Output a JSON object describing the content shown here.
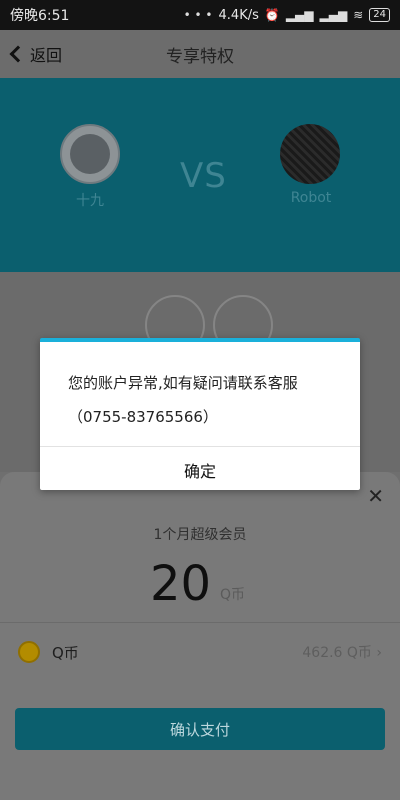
{
  "status_bar": {
    "time": "傍晚6:51",
    "net_speed": "4.4K/s",
    "battery": "24"
  },
  "header": {
    "back_label": "返回",
    "title": "专享特权"
  },
  "versus": {
    "left_name": "十九",
    "vs_text": "VS",
    "right_name": "Robot"
  },
  "sheet": {
    "close_icon": "close-icon",
    "plan_name": "1个月超级会员",
    "price": "20",
    "price_unit": "Q币",
    "payment_method": "Q币",
    "balance": "462.6 Q币",
    "confirm_label": "确认支付"
  },
  "dialog": {
    "message": "您的账户异常,如有疑问请联系客服",
    "phone": "（0755-83765566）",
    "ok_label": "确定"
  },
  "colors": {
    "accent": "#1ab0da",
    "teal_dimmed": "#0b5f6e",
    "coin": "#b38c00"
  }
}
